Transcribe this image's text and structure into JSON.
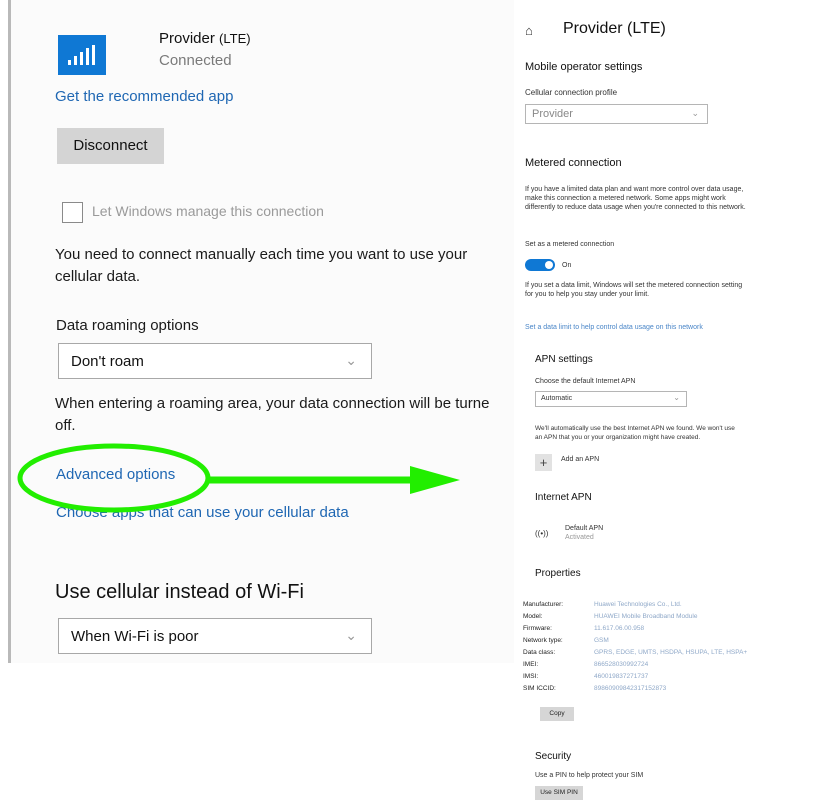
{
  "left": {
    "provider_name": "Provider",
    "provider_type": "(LTE)",
    "status": "Connected",
    "recommended_app_link": "Get the recommended app",
    "disconnect_label": "Disconnect",
    "manage_checkbox_label": "Let Windows manage this connection",
    "manual_note": [
      "You need to connect manually each time you want to use your",
      "cellular data."
    ],
    "roaming_heading": "Data roaming options",
    "roaming_value": "Don't roam",
    "roaming_note": [
      "When entering a roaming area, your data connection will be turne",
      "off."
    ],
    "advanced_options_link": "Advanced options",
    "choose_apps_link": "Choose apps that can use your cellular data",
    "cellular_heading": "Use cellular instead of Wi-Fi",
    "cellular_value": "When Wi-Fi is poor"
  },
  "right": {
    "title": "Provider (LTE)",
    "operator_heading": "Mobile operator settings",
    "profile_label": "Cellular connection profile",
    "profile_value": "Provider",
    "metered_heading": "Metered connection",
    "metered_desc": [
      "If you have a limited data plan and want more control over data usage,",
      "make this connection a metered network. Some apps might work",
      "differently to reduce data usage when you're connected to this network."
    ],
    "set_metered_label": "Set as a metered connection",
    "toggle_state": "On",
    "limit_desc": [
      "If you set a data limit, Windows will set the metered connection setting",
      "for you to help you stay under your limit."
    ],
    "data_limit_link": "Set a data limit to help control data usage on this network",
    "apn_heading": "APN settings",
    "apn_choose_label": "Choose the default Internet APN",
    "apn_value": "Automatic",
    "apn_desc": [
      "We'll automatically use the best Internet APN we found. We won't use",
      "an APN that you or your organization might have created."
    ],
    "add_apn_label": "Add an APN",
    "internet_apn_heading": "Internet APN",
    "default_apn_name": "Default APN",
    "default_apn_status": "Activated",
    "properties_heading": "Properties",
    "properties": [
      {
        "label": "Manufacturer:",
        "value": "Huawei Technologies Co., Ltd."
      },
      {
        "label": "Model:",
        "value": "HUAWEI Mobile Broadband Module"
      },
      {
        "label": "Firmware:",
        "value": "11.617.06.00.958"
      },
      {
        "label": "Network type:",
        "value": "GSM"
      },
      {
        "label": "Data class:",
        "value": "GPRS, EDGE, UMTS, HSDPA, HSUPA, LTE, HSPA+"
      },
      {
        "label": "IMEI:",
        "value": "866528030992724"
      },
      {
        "label": "IMSI:",
        "value": "460019837271737"
      },
      {
        "label": "SIM ICCID:",
        "value": "89860909842317152873"
      }
    ],
    "copy_label": "Copy",
    "security_heading": "Security",
    "security_desc": "Use a PIN to help protect your SIM",
    "sim_pin_label": "Use SIM PIN"
  },
  "colors": {
    "accent": "#0f78d4",
    "link": "#1f67b3",
    "highlight_green": "#22ee00"
  }
}
